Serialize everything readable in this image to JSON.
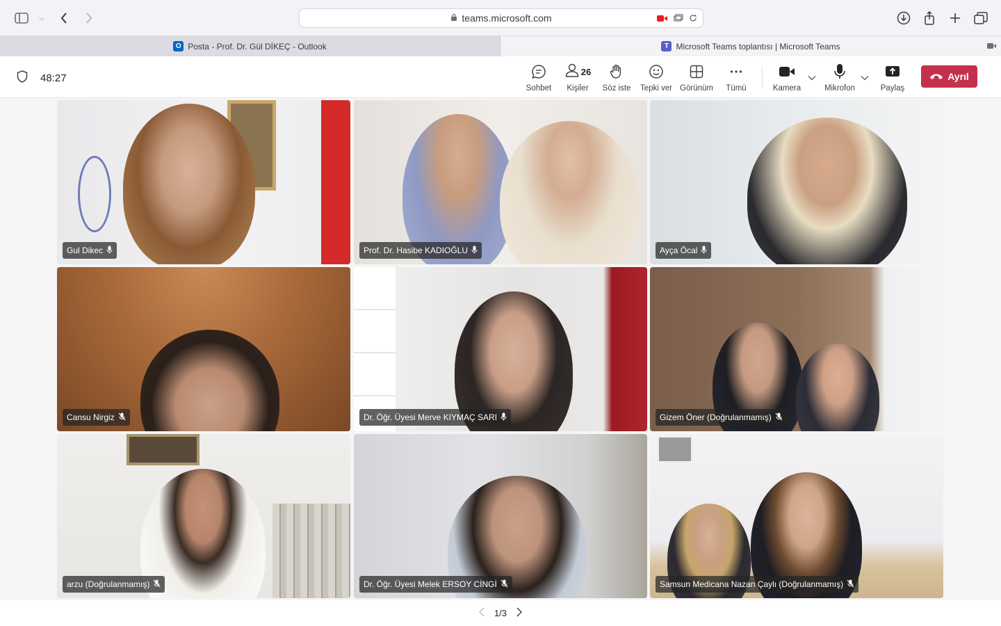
{
  "browser": {
    "url": "teams.microsoft.com",
    "tabs": [
      {
        "title": "Posta - Prof. Dr. Gül DİKEÇ - Outlook",
        "favicon": "outlook-icon"
      },
      {
        "title": "Microsoft Teams toplantısı | Microsoft Teams",
        "favicon": "teams-icon"
      }
    ]
  },
  "meeting": {
    "timer": "48:27",
    "controls": {
      "chat": "Sohbet",
      "people": "Kişiler",
      "people_count": "26",
      "raise_hand": "Söz iste",
      "react": "Tepki ver",
      "view": "Görünüm",
      "more": "Tümü",
      "camera": "Kamera",
      "mic": "Mikrofon",
      "share": "Paylaş",
      "leave": "Ayrıl"
    },
    "colors": {
      "leave": "#c4314b",
      "tag_bg": "#242424"
    },
    "participants": [
      {
        "name": "Gul Dikec",
        "mic": "mic-on"
      },
      {
        "name": "Prof. Dr. Hasibe KADIOĞLU",
        "mic": "mic-on"
      },
      {
        "name": "Ayça Öcal",
        "mic": "mic-on"
      },
      {
        "name": "Cansu Nirgiz",
        "mic": "mic-muted"
      },
      {
        "name": "Dr. Öğr. Üyesi Merve KIYMAÇ SARI",
        "mic": "mic-on"
      },
      {
        "name": "Gizem Öner (Doğrulanmamış)",
        "mic": "mic-muted"
      },
      {
        "name": "arzu (Doğrulanmamış)",
        "mic": "mic-muted"
      },
      {
        "name": "Dr. Öğr. Üyesi Melek ERSOY CİNGİ",
        "mic": "mic-muted"
      },
      {
        "name": "Samsun Medicana Nazan Çaylı (Doğrulanmamış)",
        "mic": "mic-muted"
      }
    ],
    "pager": "1/3"
  }
}
